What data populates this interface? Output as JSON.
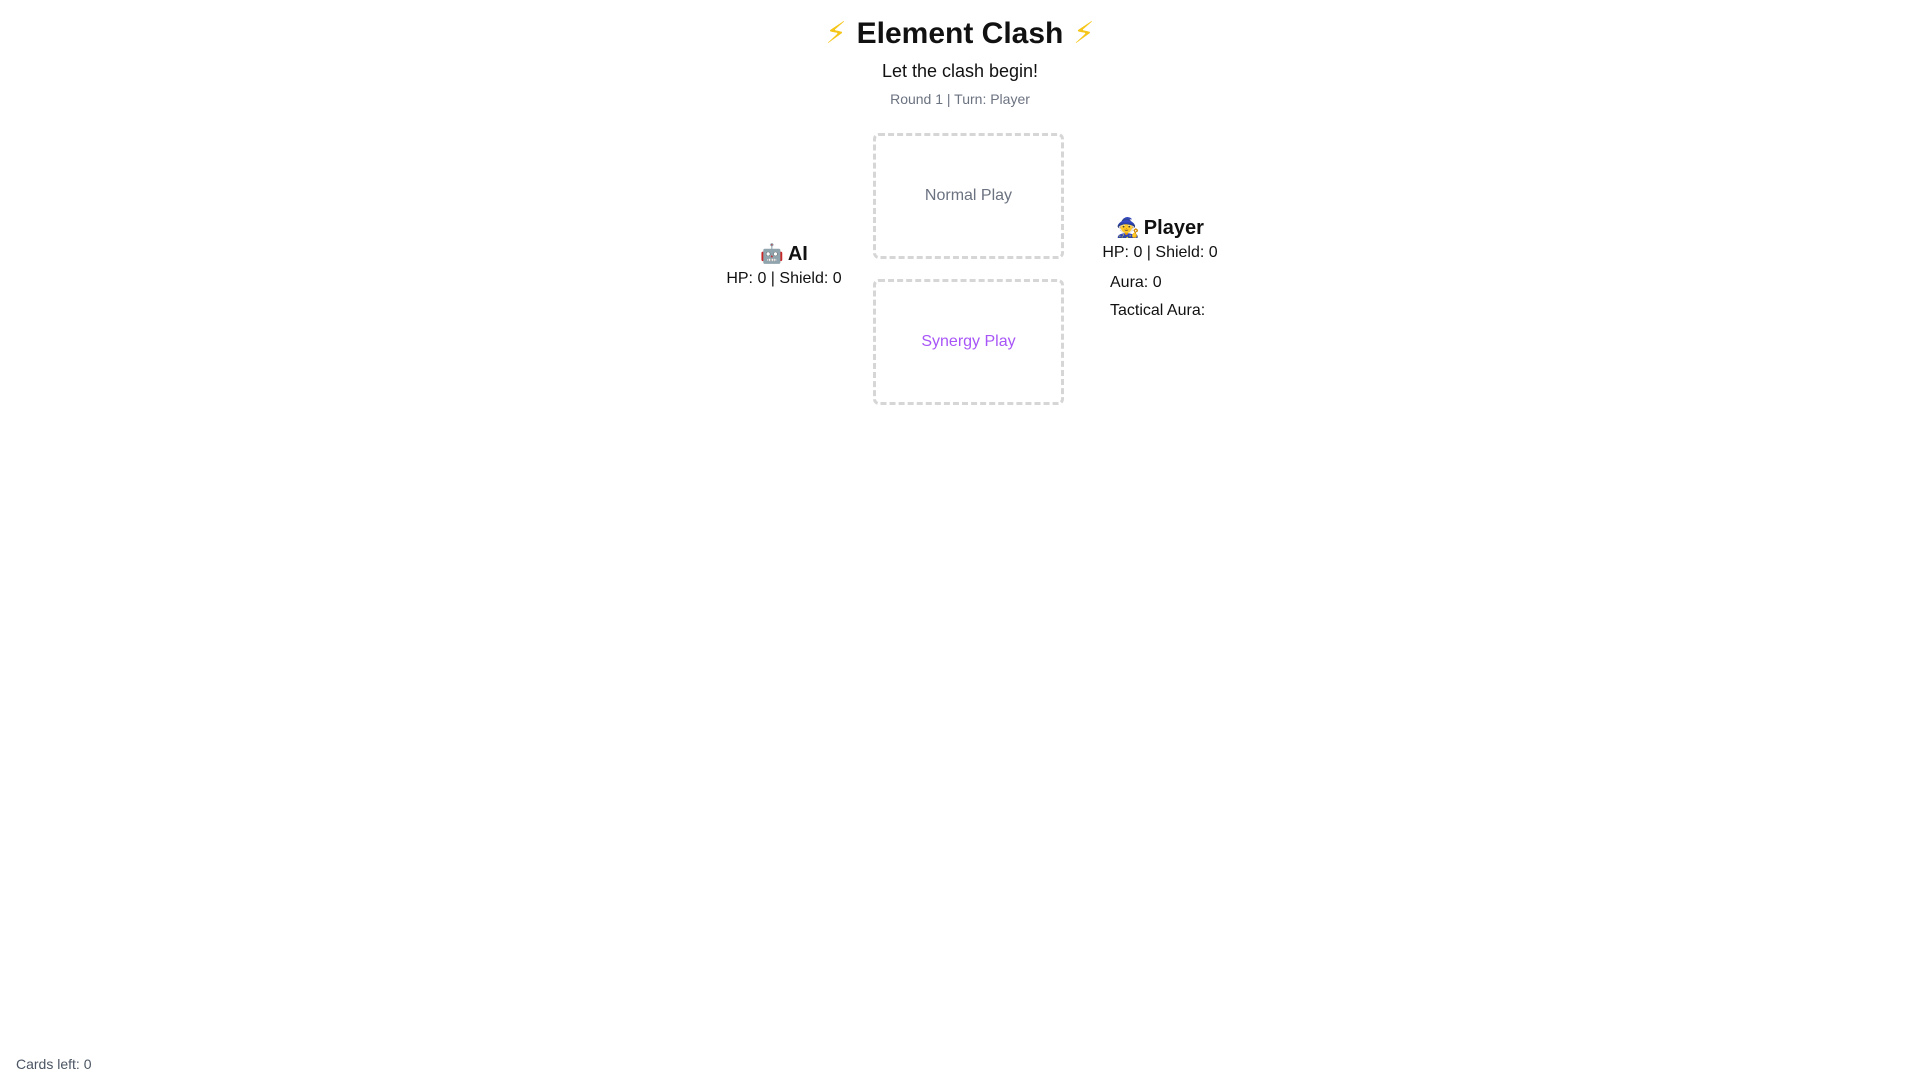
{
  "header": {
    "bolt_icon": "⚡",
    "title": "Element Clash",
    "subtitle": "Let the clash begin!",
    "round_info": "Round 1 | Turn: Player"
  },
  "ai": {
    "avatar_icon": "🤖",
    "name": "AI",
    "stats": "HP: 0 | Shield: 0"
  },
  "player": {
    "avatar_icon": "🧙",
    "name": "Player",
    "stats": "HP: 0 | Shield: 0",
    "aura": "Aura: 0",
    "tactical_aura": "Tactical Aura:"
  },
  "zones": {
    "normal": "Normal Play",
    "synergy": "Synergy Play"
  },
  "footer": {
    "cards_left": "Cards left: 0"
  },
  "colors": {
    "bolt": "#f5c518",
    "synergy": "#a855f7",
    "muted": "#6b7280",
    "zone_border": "#d6d6d6"
  }
}
